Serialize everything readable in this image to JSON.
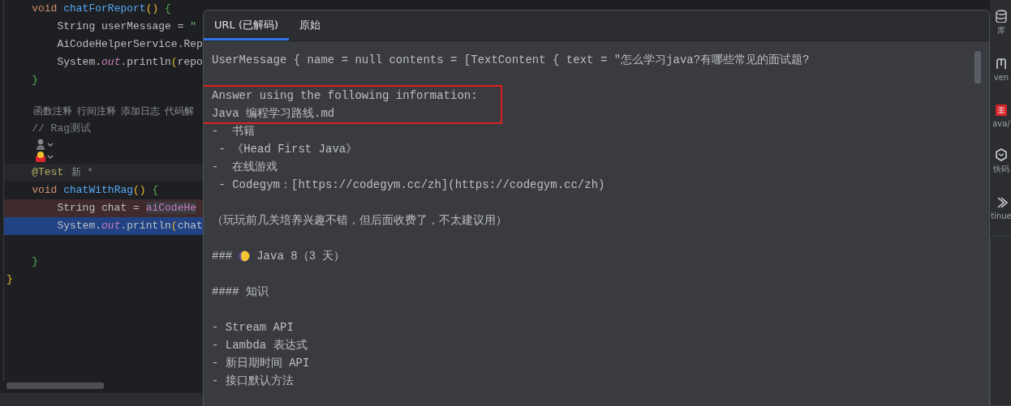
{
  "editor": {
    "lines": [
      {
        "kind": "code",
        "tokens": [
          {
            "kind": "kw",
            "t": "    void "
          },
          {
            "kind": "fn",
            "t": "chatForReport"
          },
          {
            "kind": "paren",
            "t": "()"
          },
          {
            "kind": "brace",
            "t": " {"
          }
        ]
      },
      {
        "kind": "code",
        "tokens": [
          {
            "kind": "id",
            "t": "        String userMessage = "
          },
          {
            "kind": "str",
            "t": "\""
          }
        ]
      },
      {
        "kind": "code",
        "tokens": [
          {
            "kind": "id",
            "t": "        AiCodeHelperService.Rep"
          }
        ]
      },
      {
        "kind": "code",
        "tokens": [
          {
            "kind": "id",
            "t": "        System."
          },
          {
            "kind": "field",
            "t": "out"
          },
          {
            "kind": "id",
            "t": ".println"
          },
          {
            "kind": "paren",
            "t": "("
          },
          {
            "kind": "id",
            "t": "repo"
          }
        ]
      },
      {
        "kind": "code",
        "tokens": [
          {
            "kind": "brace",
            "t": "    }"
          }
        ]
      },
      {
        "kind": "hints",
        "space_before": true,
        "hints": [
          "函数注释",
          "行间注释",
          "添加日志",
          "代码解"
        ]
      },
      {
        "kind": "code",
        "tokens": [
          {
            "kind": "comment",
            "t": "    // Rag测试"
          }
        ]
      },
      {
        "kind": "author-icons"
      },
      {
        "kind": "code",
        "current": true,
        "tokens": [
          {
            "kind": "ann",
            "t": "    @Test"
          }
        ],
        "hint": "新 *"
      },
      {
        "kind": "code",
        "tokens": [
          {
            "kind": "kw",
            "t": "    void "
          },
          {
            "kind": "fn",
            "t": "chatWithRag"
          },
          {
            "kind": "paren",
            "t": "()"
          },
          {
            "kind": "brace",
            "t": " {"
          }
        ]
      },
      {
        "kind": "code",
        "error": true,
        "tokens": [
          {
            "kind": "id",
            "t": "        String chat = "
          },
          {
            "kind": "member",
            "t": "aiCodeHe"
          }
        ]
      },
      {
        "kind": "code",
        "selected": true,
        "tokens": [
          {
            "kind": "id",
            "t": "        System."
          },
          {
            "kind": "field",
            "t": "out"
          },
          {
            "kind": "id",
            "t": ".println"
          },
          {
            "kind": "paren",
            "t": "("
          },
          {
            "kind": "id",
            "t": "chat"
          }
        ]
      },
      {
        "kind": "code",
        "space_before": true,
        "tokens": [
          {
            "kind": "brace",
            "t": "    }"
          }
        ]
      },
      {
        "kind": "code",
        "tokens": [
          {
            "kind": "paren",
            "t": "}"
          }
        ]
      }
    ]
  },
  "popup": {
    "tabs": [
      {
        "label": "URL (已解码)",
        "selected": true
      },
      {
        "label": "原始",
        "selected": false
      }
    ],
    "lines": [
      {
        "kind": "line",
        "text": "UserMessage { name = null contents = [TextContent { text = \"怎么学习java?有哪些常见的面试题?"
      },
      {
        "kind": "boxed",
        "space_before": true,
        "lines": [
          {
            "text": "Answer using the following information:"
          },
          {
            "text": "Java 编程学习路线.md"
          }
        ]
      },
      {
        "kind": "line",
        "text": "-  书籍"
      },
      {
        "kind": "line",
        "text": " - 《Head First Java》"
      },
      {
        "kind": "line",
        "text": "-  在线游戏"
      },
      {
        "kind": "line",
        "text": " - Codegym：[https://codegym.cc/zh](https://codegym.cc/zh)"
      },
      {
        "kind": "line",
        "text": "（玩玩前几关培养兴趣不错，但后面收费了，不太建议用）",
        "space_before": true
      },
      {
        "kind": "line",
        "text": "###",
        "after_icon": "Java 8（3 天）",
        "space_before": true
      },
      {
        "kind": "line",
        "text": "#### 知识",
        "space_before": true
      },
      {
        "kind": "line",
        "text": "- Stream API",
        "space_before": true
      },
      {
        "kind": "line",
        "text": "- Lambda 表达式"
      },
      {
        "kind": "line",
        "text": "- 新日期时间 API"
      },
      {
        "kind": "line",
        "text": "- 接口默认方法"
      }
    ]
  },
  "tool_strip": {
    "items": [
      {
        "kind": "database",
        "label": "库"
      },
      {
        "kind": "maven",
        "label": "ven"
      },
      {
        "kind": "badge",
        "label": "ava/"
      },
      {
        "kind": "hexagon",
        "label": "快码"
      },
      {
        "kind": "chevron",
        "label": "tinue"
      }
    ]
  }
}
